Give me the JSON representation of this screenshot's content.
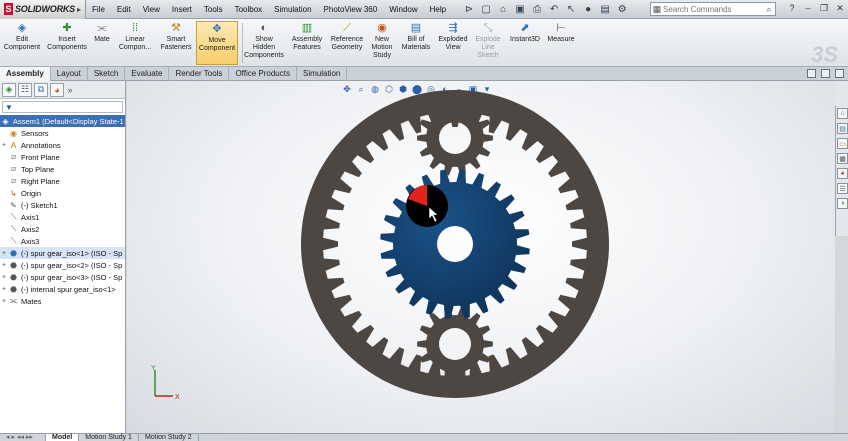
{
  "app": {
    "name": "SOLIDWORKS",
    "logo_mark": "S"
  },
  "menu": [
    "File",
    "Edit",
    "View",
    "Insert",
    "Tools",
    "Toolbox",
    "Simulation",
    "PhotoView 360",
    "Window",
    "Help"
  ],
  "search": {
    "placeholder": "Search Commands"
  },
  "toolbar": {
    "edit_component": "Edit Component",
    "insert_components": "Insert Components",
    "mate": "Mate",
    "linear_component": "Linear Compon...",
    "smart_fasteners": "Smart Fasteners",
    "move_component": "Move Component",
    "show_hidden": "Show Hidden Components",
    "assembly_features": "Assembly Features",
    "reference_geometry": "Reference Geometry",
    "new_motion_study": "New Motion Study",
    "bill_of_materials": "Bill of Materials",
    "exploded_view": "Exploded View",
    "explode_line_sketch": "Explode Line Sketch",
    "instant3d": "Instant3D",
    "measure": "Measure"
  },
  "command_tabs": [
    "Assembly",
    "Layout",
    "Sketch",
    "Evaluate",
    "Render Tools",
    "Office Products",
    "Simulation"
  ],
  "tree": {
    "filter_icon": "funnel-icon",
    "root": "Assem1  (Default<Display State-1",
    "items": [
      {
        "label": "Sensors",
        "icon": "sensor-icon",
        "expandable": false
      },
      {
        "label": "Annotations",
        "icon": "annotation-icon",
        "expandable": true
      },
      {
        "label": "Front Plane",
        "icon": "plane-icon",
        "expandable": false
      },
      {
        "label": "Top Plane",
        "icon": "plane-icon",
        "expandable": false
      },
      {
        "label": "Right Plane",
        "icon": "plane-icon",
        "expandable": false
      },
      {
        "label": "Origin",
        "icon": "origin-icon",
        "expandable": false
      },
      {
        "label": "(-) Sketch1",
        "icon": "sketch-icon",
        "expandable": false
      },
      {
        "label": "Axis1",
        "icon": "axis-icon",
        "expandable": false
      },
      {
        "label": "Axis2",
        "icon": "axis-icon",
        "expandable": false
      },
      {
        "label": "Axis3",
        "icon": "axis-icon",
        "expandable": false
      },
      {
        "label": "(-) spur gear_iso<1> (ISO - Sp",
        "icon": "part-icon",
        "expandable": true,
        "selected": true
      },
      {
        "label": "(-) spur gear_iso<2> (ISO - Sp",
        "icon": "part-icon",
        "expandable": true
      },
      {
        "label": "(-) spur gear_iso<3> (ISO - Sp",
        "icon": "part-icon",
        "expandable": true
      },
      {
        "label": "(-) internal spur gear_iso<1>",
        "icon": "part-icon",
        "expandable": true
      },
      {
        "label": "Mates",
        "icon": "mates-icon",
        "expandable": true
      }
    ]
  },
  "bottom_tabs": [
    "Model",
    "Motion Study 1",
    "Motion Study 2"
  ],
  "colors": {
    "ring_gear": "#4d4744",
    "sun_gear": "#123e66",
    "planet_gear": "#4d4744",
    "selection": "#3d6fb8"
  },
  "triad": {
    "x": "X",
    "y": "Y"
  }
}
